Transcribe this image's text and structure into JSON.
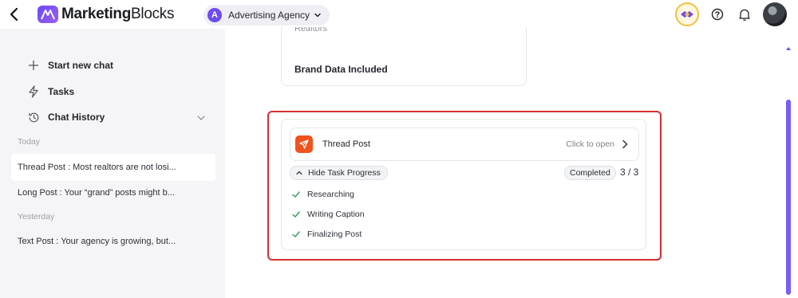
{
  "header": {
    "logo_text_bold": "Marketing",
    "logo_text_regular": "Blocks",
    "agency_initial": "A",
    "agency_name": "Advertising Agency"
  },
  "sidebar": {
    "start_new_chat": "Start new chat",
    "tasks": "Tasks",
    "chat_history": "Chat History",
    "sections": [
      {
        "label": "Today",
        "items": [
          "Thread Post : Most realtors are not losi..."
        ]
      },
      {
        "label": "Yesterday",
        "items": [
          "Text Post : Your agency is growing, but..."
        ]
      }
    ],
    "today_second_item": "Long Post : Your “grand” posts might b..."
  },
  "main": {
    "previous_card": {
      "cut_text": "Realtors",
      "brand_data": "Brand Data Included"
    },
    "task_card": {
      "title": "Thread Post",
      "click_to_open": "Click to open",
      "hide_progress": "Hide Task Progress",
      "status": "Completed",
      "progress": "3 / 3",
      "steps": [
        "Researching",
        "Writing Caption",
        "Finalizing Post"
      ]
    }
  },
  "colors": {
    "accent": "#6c4cf1",
    "task_icon": "#f0521e",
    "highlight": "#d92e2e",
    "check": "#2f9e5a"
  },
  "icons": {
    "back": "chevron-left-icon",
    "logo": "logo-mark-icon",
    "coin": "rewards-coin-icon",
    "help": "help-circle-icon",
    "notifications": "bell-icon",
    "new_chat": "plus-icon",
    "tasks": "bolt-icon",
    "history": "clock-history-icon",
    "task": "send-icon",
    "step": "check-icon"
  }
}
